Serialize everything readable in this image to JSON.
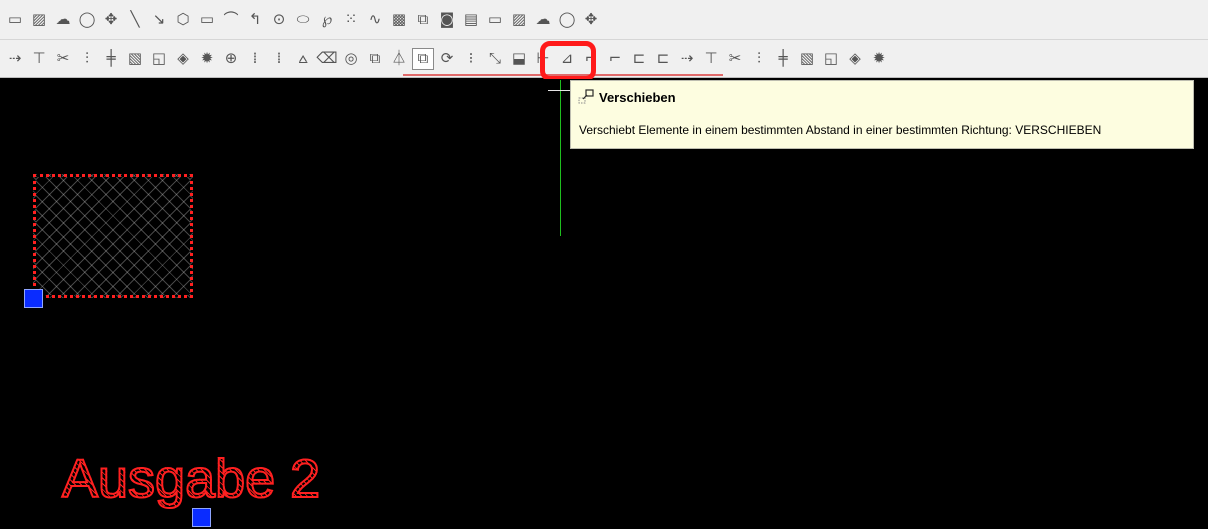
{
  "toolbar_top": {
    "icons": [
      {
        "name": "text-icon",
        "glyph": "▭"
      },
      {
        "name": "pencil-hatch-icon",
        "glyph": "▨"
      },
      {
        "name": "cloud-icon",
        "glyph": "☁"
      },
      {
        "name": "circle-icon",
        "glyph": "◯"
      },
      {
        "name": "revcloud-icon",
        "glyph": "✥"
      },
      {
        "name": "line-icon",
        "glyph": "╲"
      },
      {
        "name": "polyline-icon",
        "glyph": "↘"
      },
      {
        "name": "polygon-icon",
        "glyph": "⬡"
      },
      {
        "name": "rectangle-icon",
        "glyph": "▭"
      },
      {
        "name": "arc-icon",
        "glyph": "⌒"
      },
      {
        "name": "arc2-icon",
        "glyph": "↰"
      },
      {
        "name": "circle-center-icon",
        "glyph": "⊙"
      },
      {
        "name": "ellipse-icon",
        "glyph": "⬭"
      },
      {
        "name": "ellipse-arc-icon",
        "glyph": "℘"
      },
      {
        "name": "point-icon",
        "glyph": "⁙"
      },
      {
        "name": "spline-icon",
        "glyph": "∿"
      },
      {
        "name": "hatch-icon",
        "glyph": "▩"
      },
      {
        "name": "block-insert-icon",
        "glyph": "⧉"
      },
      {
        "name": "region-icon",
        "glyph": "◙"
      },
      {
        "name": "mtext-icon",
        "glyph": "▤"
      },
      {
        "name": "text2-icon",
        "glyph": "▭"
      },
      {
        "name": "pencil-hatch2-icon",
        "glyph": "▨"
      },
      {
        "name": "cloud2-icon",
        "glyph": "☁"
      },
      {
        "name": "circle2-icon",
        "glyph": "◯"
      },
      {
        "name": "revcloud2-icon",
        "glyph": "✥"
      }
    ]
  },
  "toolbar_modify": {
    "icons": [
      {
        "name": "extend-icon",
        "glyph": "⇢"
      },
      {
        "name": "trim-icon",
        "glyph": "⊤"
      },
      {
        "name": "break-icon",
        "glyph": "✂"
      },
      {
        "name": "join-icon",
        "glyph": "⫶"
      },
      {
        "name": "break-at-point-icon",
        "glyph": "╪"
      },
      {
        "name": "edit-hatch-icon",
        "glyph": "▧"
      },
      {
        "name": "draworder-icon",
        "glyph": "◱"
      },
      {
        "name": "paint-icon",
        "glyph": "◈"
      },
      {
        "name": "explode-icon",
        "glyph": "✹"
      },
      {
        "name": "array-icon",
        "glyph": "⊕"
      },
      {
        "name": "grid-icon",
        "glyph": "⁞"
      },
      {
        "name": "grid2-icon",
        "glyph": "⁞"
      },
      {
        "name": "align-icon",
        "glyph": "⩟"
      },
      {
        "name": "erase-icon",
        "glyph": "⌫"
      },
      {
        "name": "offset-icon",
        "glyph": "◎"
      },
      {
        "name": "copy-icon",
        "glyph": "⧉"
      },
      {
        "name": "mirror-icon",
        "glyph": "⏃"
      },
      {
        "name": "move-icon",
        "glyph": "⧉"
      },
      {
        "name": "rotate-icon",
        "glyph": "⟳"
      },
      {
        "name": "rect-array-icon",
        "glyph": "⁝"
      },
      {
        "name": "scale-icon",
        "glyph": "⤡"
      },
      {
        "name": "stretch-icon",
        "glyph": "⬓"
      },
      {
        "name": "lengthen-icon",
        "glyph": "⊢"
      },
      {
        "name": "chamfer-icon",
        "glyph": "⊿"
      },
      {
        "name": "fillet-icon",
        "glyph": "⌐"
      },
      {
        "name": "fillet2-icon",
        "glyph": "⌐"
      },
      {
        "name": "blend-icon",
        "glyph": "⊏"
      },
      {
        "name": "blend2-icon",
        "glyph": "⊏"
      },
      {
        "name": "extend2-icon",
        "glyph": "⇢"
      },
      {
        "name": "trim2-icon",
        "glyph": "⊤"
      },
      {
        "name": "break2-icon",
        "glyph": "✂"
      },
      {
        "name": "join2-icon",
        "glyph": "⫶"
      },
      {
        "name": "break-at-point2-icon",
        "glyph": "╪"
      },
      {
        "name": "edit-hatch2-icon",
        "glyph": "▧"
      },
      {
        "name": "draworder2-icon",
        "glyph": "◱"
      },
      {
        "name": "paint2-icon",
        "glyph": "◈"
      },
      {
        "name": "explode2-icon",
        "glyph": "✹"
      }
    ],
    "active_icon": "move-icon"
  },
  "tooltip": {
    "title": "Verschieben",
    "description": "Verschiebt Elemente in einem bestimmten Abstand in einer bestimmten Richtung: VERSCHIEBEN"
  },
  "drawing": {
    "text": "Ausgabe 2"
  },
  "colors": {
    "canvas_bg": "#000000",
    "entity_red": "#ff2020",
    "grip_blue": "#0a2cff",
    "crosshair_green": "#1fbf1f",
    "tooltip_bg": "#fdfde0",
    "highlight_red": "#ff1a1a"
  }
}
